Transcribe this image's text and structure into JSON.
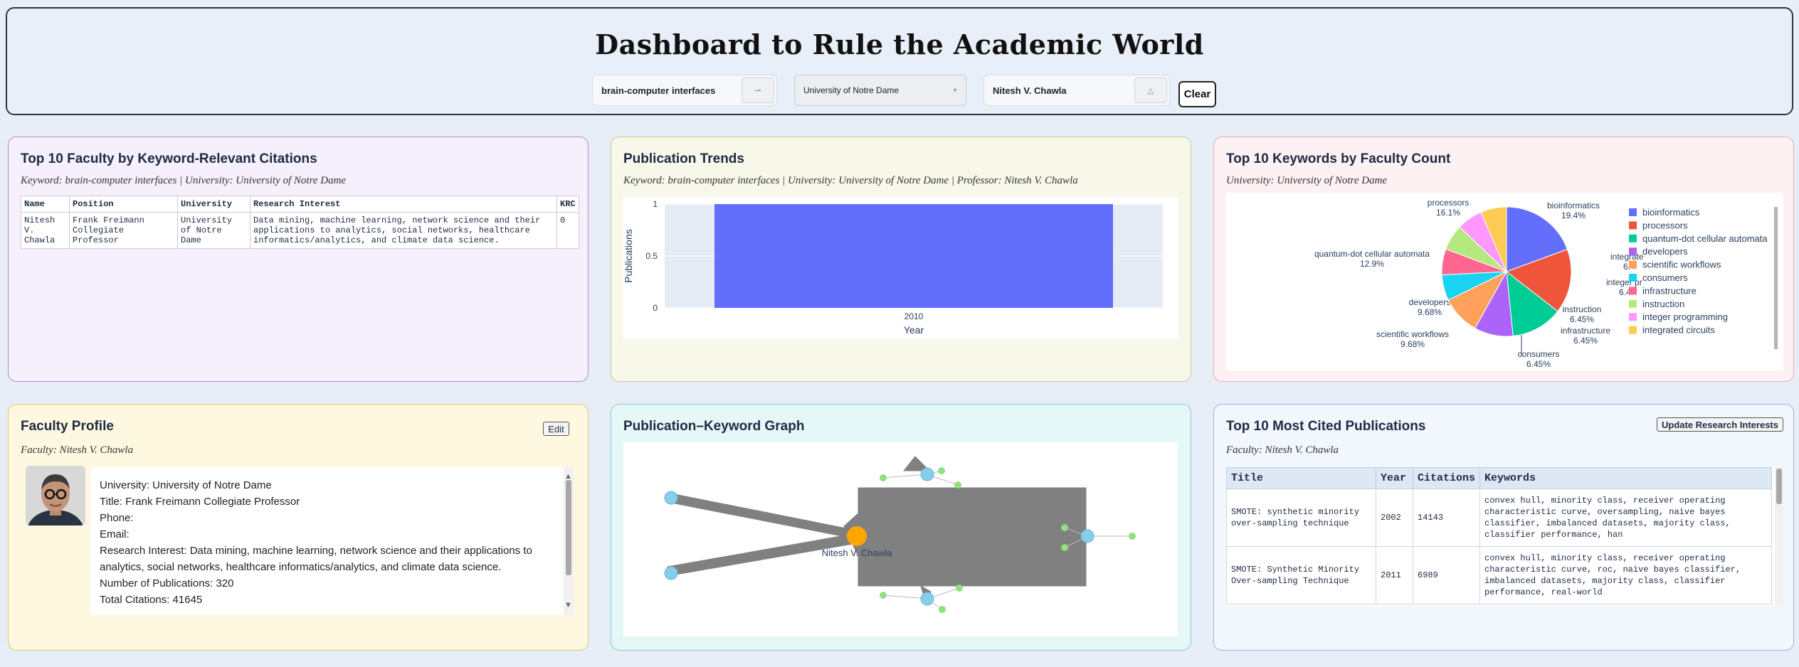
{
  "header": {
    "title": "Dashboard to Rule the Academic World",
    "keyword_value": "brain-computer interfaces",
    "university_value": "University of Notre Dame",
    "professor_value": "Nitesh V. Chawla",
    "clear_label": "Clear"
  },
  "faculty_table": {
    "title": "Top 10 Faculty by Keyword-Relevant Citations",
    "subtitle": "Keyword: brain-computer interfaces | University: University of Notre Dame",
    "columns": [
      "Name",
      "Position",
      "University",
      "Research Interest",
      "KRC"
    ],
    "rows": [
      [
        "Nitesh V. Chawla",
        "Frank Freimann Collegiate Professor",
        "University of Notre Dame",
        "Data mining, machine learning, network science and their applications to analytics, social networks, healthcare informatics/analytics, and climate data science.",
        "0"
      ]
    ]
  },
  "publication_trends": {
    "title": "Publication Trends",
    "subtitle": "Keyword: brain-computer interfaces | University: University of Notre Dame | Professor: Nitesh V. Chawla"
  },
  "keywords_pie": {
    "title": "Top 10 Keywords by Faculty Count",
    "subtitle": "University: University of Notre Dame"
  },
  "profile": {
    "title": "Faculty Profile",
    "edit_label": "Edit",
    "subtitle": "Faculty: Nitesh V. Chawla",
    "university": "University: University of Notre Dame",
    "position": "Title: Frank Freimann Collegiate Professor",
    "phone": "Phone:",
    "email": "Email:",
    "research_interest": "Research Interest: Data mining, machine learning, network science and their applications to analytics, social networks, healthcare informatics/analytics, and climate data science.",
    "num_publications": "Number of Publications: 320",
    "total_citations": "Total Citations: 41645"
  },
  "graph": {
    "title": "Publication–Keyword Graph",
    "center_label": "Nitesh V. Chawla"
  },
  "top_pubs": {
    "title": "Top 10 Most Cited Publications",
    "update_label": "Update Research Interests",
    "subtitle": "Faculty: Nitesh V. Chawla",
    "columns": [
      "Title",
      "Year",
      "Citations",
      "Keywords"
    ],
    "rows": [
      [
        "SMOTE: synthetic minority over-sampling technique",
        "2002",
        "14143",
        "convex hull, minority class, receiver operating characteristic curve, oversampling, naive bayes classifier, imbalanced datasets, majority class, classifier performance, han"
      ],
      [
        "SMOTE: Synthetic Minority Over-sampling Technique",
        "2011",
        "6989",
        "convex hull, minority class, receiver operating characteristic curve, roc, naive bayes classifier, imbalanced datasets, majority class, classifier performance, real-world"
      ]
    ]
  },
  "chart_data": [
    {
      "type": "bar",
      "categories": [
        "2010"
      ],
      "values": [
        1
      ],
      "xlabel": "Year",
      "ylabel": "Publications",
      "yticks": [
        "0",
        "0.5",
        "1"
      ],
      "ylim": [
        0,
        1
      ],
      "color": "#636efa"
    },
    {
      "type": "pie",
      "labels": [
        "bioinformatics",
        "processors",
        "quantum-dot cellular automata",
        "developers",
        "scientific workflows",
        "consumers",
        "infrastructure",
        "instruction",
        "integer programming",
        "integrated circuits"
      ],
      "values": [
        19.4,
        16.1,
        12.9,
        9.68,
        9.68,
        6.45,
        6.45,
        6.45,
        6.45,
        6.45
      ],
      "colors": [
        "#636efa",
        "#ef553b",
        "#00cc96",
        "#ab63fa",
        "#ffa15a",
        "#19d3f3",
        "#ff6692",
        "#b6e880",
        "#ff97ff",
        "#fecb52"
      ],
      "slice_labels": [
        {
          "name": "bioinformatics",
          "pct": "19.4%"
        },
        {
          "name": "processors",
          "pct": "16.1%"
        },
        {
          "name": "quantum-dot cellular automata",
          "pct": "12.9%"
        },
        {
          "name": "developers",
          "pct": "9.68%"
        },
        {
          "name": "scientific workflows",
          "pct": "9.68%"
        },
        {
          "name": "consumers",
          "pct": "6.45%"
        },
        {
          "name": "infrastructure",
          "pct": "6.45%"
        },
        {
          "name": "instruction",
          "pct": "6.45%"
        },
        {
          "name": "integer pr",
          "pct": "6.4"
        },
        {
          "name": "integrate",
          "pct": "6.4"
        }
      ],
      "legend_position": "right"
    }
  ]
}
